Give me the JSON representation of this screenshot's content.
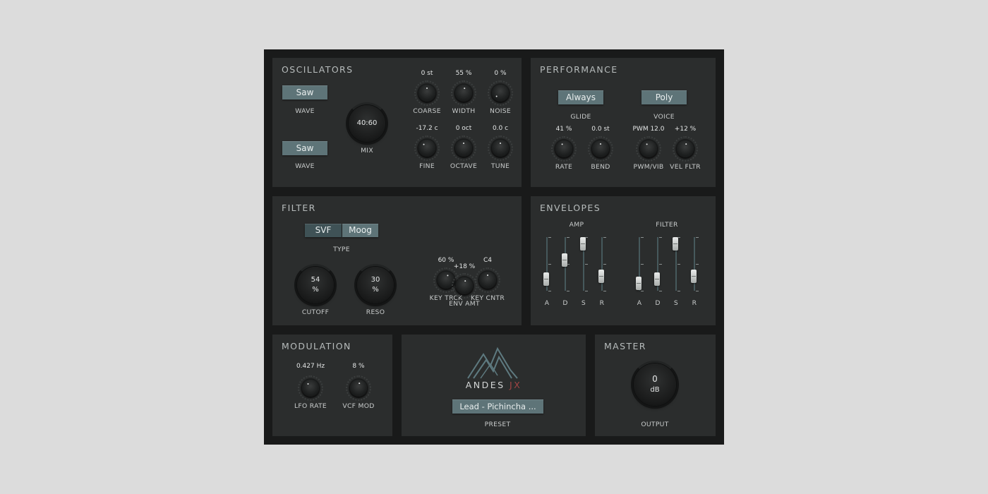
{
  "oscillators": {
    "title": "OSCILLATORS",
    "wave1": {
      "value": "Saw",
      "label": "WAVE"
    },
    "wave2": {
      "value": "Saw",
      "label": "WAVE"
    },
    "mix": {
      "value": "40:60",
      "label": "MIX"
    },
    "knobs": [
      {
        "label": "COARSE",
        "value": "0 st"
      },
      {
        "label": "WIDTH",
        "value": "55 %"
      },
      {
        "label": "NOISE",
        "value": "0 %"
      },
      {
        "label": "FINE",
        "value": "-17.2 c"
      },
      {
        "label": "OCTAVE",
        "value": "0 oct"
      },
      {
        "label": "TUNE",
        "value": "0.0 c"
      }
    ]
  },
  "performance": {
    "title": "PERFORMANCE",
    "glide": {
      "value": "Always",
      "label": "GLIDE"
    },
    "voice": {
      "value": "Poly",
      "label": "VOICE"
    },
    "knobs": [
      {
        "label": "RATE",
        "value": "41 %"
      },
      {
        "label": "BEND",
        "value": "0.0 st"
      },
      {
        "label": "PWM/VIB",
        "value": "PWM 12.0"
      },
      {
        "label": "VEL FLTR",
        "value": "+12 %"
      }
    ]
  },
  "filter": {
    "title": "FILTER",
    "type_options": [
      "SVF",
      "Moog"
    ],
    "type_selected": "Moog",
    "type_label": "TYPE",
    "cutoff": {
      "value": "54",
      "unit": "%",
      "label": "CUTOFF"
    },
    "reso": {
      "value": "30",
      "unit": "%",
      "label": "RESO"
    },
    "knobs": [
      {
        "label": "KEY TRCK",
        "value": "60 %"
      },
      {
        "label": "KEY CNTR",
        "value": "C4"
      },
      {
        "label": "ENV AMT",
        "value": "+18 %"
      }
    ]
  },
  "envelopes": {
    "title": "ENVELOPES",
    "amp": {
      "label": "AMP",
      "stages": [
        "A",
        "D",
        "S",
        "R"
      ],
      "levels": [
        0.12,
        0.6,
        1.0,
        0.2
      ]
    },
    "filter": {
      "label": "FILTER",
      "stages": [
        "A",
        "D",
        "S",
        "R"
      ],
      "levels": [
        0.02,
        0.12,
        1.0,
        0.2
      ]
    }
  },
  "modulation": {
    "title": "MODULATION",
    "knobs": [
      {
        "label": "LFO RATE",
        "value": "0.427 Hz"
      },
      {
        "label": "VCF MOD",
        "value": "8 %"
      }
    ]
  },
  "preset": {
    "brand": "ANDES",
    "brand_suffix": "JX",
    "name": "Lead - Pichincha ...",
    "label": "PRESET"
  },
  "master": {
    "title": "MASTER",
    "output": {
      "value": "0",
      "unit": "dB",
      "label": "OUTPUT"
    }
  },
  "colors": {
    "background": "#dcdcdc",
    "frame": "#191a1a",
    "panel": "#2b2d2d",
    "button": "#5e7478",
    "accent_red": "#a34545",
    "logo_line": "#5e7a80"
  },
  "icons": [
    "mountain-logo-icon"
  ]
}
